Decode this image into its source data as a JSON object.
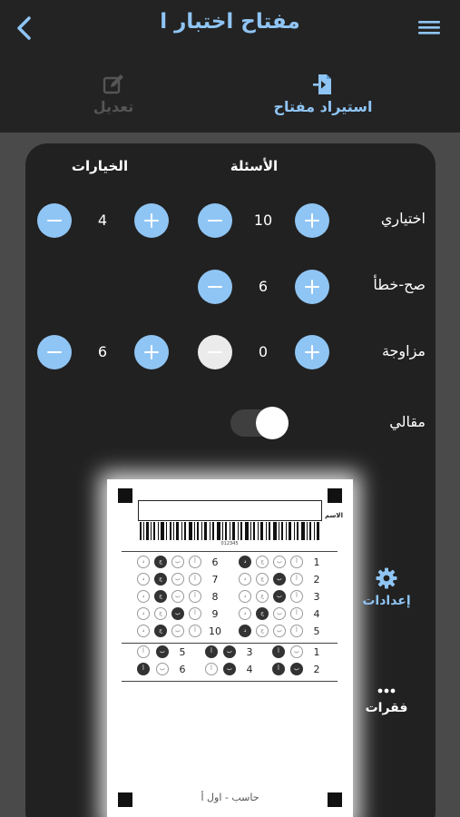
{
  "header": {
    "title": "مفتاح اختبار ا",
    "back_icon": "chevron-left-icon",
    "menu_icon": "hamburger-menu-icon"
  },
  "actions": {
    "import_label": "استيراد مفتاح",
    "edit_label": "تعديل"
  },
  "columns": {
    "questions": "الأسئلة",
    "choices": "الخيارات"
  },
  "rows": {
    "mcq": {
      "label": "اختياري",
      "questions": "10",
      "choices": "4"
    },
    "truefalse": {
      "label": "صح-خطأ",
      "questions": "6"
    },
    "matching": {
      "label": "مزاوجة",
      "questions": "0",
      "choices": "6"
    },
    "essay": {
      "label": "مقالي",
      "enabled": true
    }
  },
  "sheet": {
    "name_label": "الاسم",
    "barcode_number": "012345",
    "footer": "حاسب - اول أ",
    "left_questions": [
      "6",
      "7",
      "8",
      "9",
      "10"
    ],
    "right_questions": [
      "1",
      "2",
      "3",
      "4",
      "5"
    ],
    "match_left_questions": [
      "5",
      "6"
    ],
    "match_mid_questions": [
      "3",
      "4"
    ],
    "match_right_questions": [
      "1",
      "2"
    ],
    "bubble_labels": [
      "أ",
      "ب",
      "ج",
      "د"
    ]
  },
  "sidebar": {
    "settings_label": "إعدادات",
    "items_label": "فقرات"
  },
  "colors": {
    "accent": "#8fc5f4",
    "background": "#4a4a4a",
    "panel": "#212121"
  }
}
